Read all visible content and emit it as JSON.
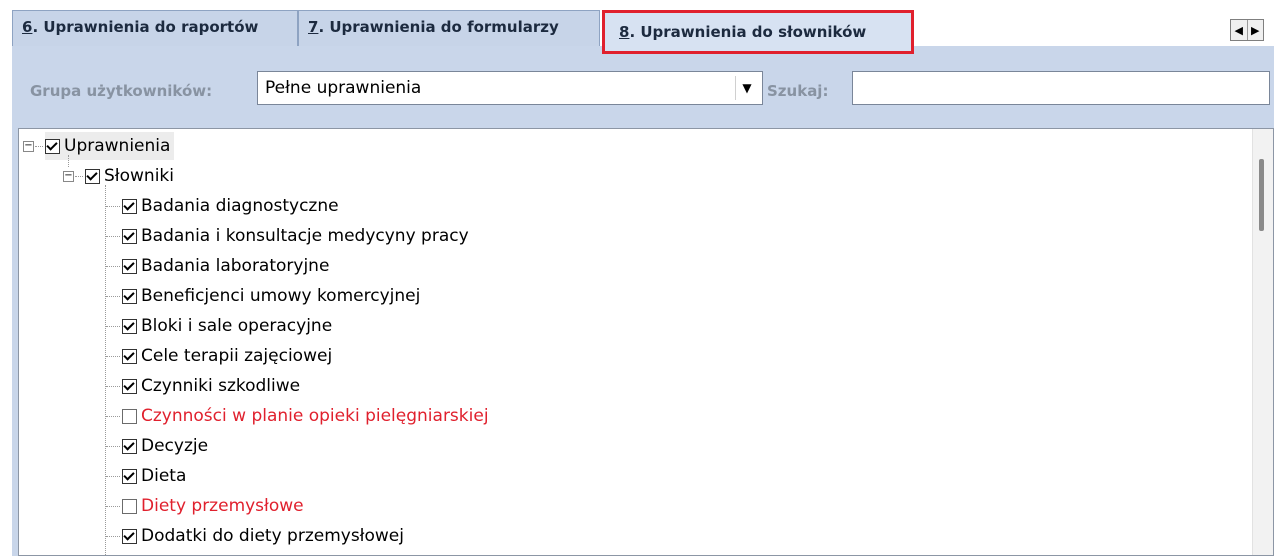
{
  "tabs": [
    {
      "hotkey": "6",
      "rest": ". Uprawnienia do raportów"
    },
    {
      "hotkey": "7",
      "rest": ". Uprawnienia do formularzy"
    },
    {
      "hotkey": "8",
      "rest": ". Uprawnienia do słowników"
    }
  ],
  "tab_scroll": {
    "left_icon": "arrow-left-icon",
    "right_icon": "arrow-right-icon"
  },
  "filter": {
    "group_label": "Grupa użytkowników:",
    "group_value": "Pełne uprawnienia",
    "search_label": "Szukaj:",
    "search_value": ""
  },
  "tree": {
    "root": {
      "label": "Uprawnienia",
      "checked": true,
      "expanded": true
    },
    "folder": {
      "label": "Słowniki",
      "checked": true,
      "expanded": true
    },
    "items": [
      {
        "label": "Badania diagnostyczne",
        "checked": true
      },
      {
        "label": "Badania i konsultacje medycyny pracy",
        "checked": true
      },
      {
        "label": "Badania laboratoryjne",
        "checked": true
      },
      {
        "label": "Beneficjenci umowy komercyjnej",
        "checked": true
      },
      {
        "label": "Bloki i sale operacyjne",
        "checked": true
      },
      {
        "label": "Cele terapii zajęciowej",
        "checked": true
      },
      {
        "label": "Czynniki szkodliwe",
        "checked": true
      },
      {
        "label": "Czynności w planie opieki pielęgniarskiej",
        "checked": false
      },
      {
        "label": "Decyzje",
        "checked": true
      },
      {
        "label": "Dieta",
        "checked": true
      },
      {
        "label": "Diety przemysłowe",
        "checked": false
      },
      {
        "label": "Dodatki do diety przemysłowej",
        "checked": true
      }
    ]
  },
  "colors": {
    "unchecked_text": "#e0202d",
    "active_tab_outline": "#e0202d",
    "panel_bg": "#c9d6ea"
  }
}
